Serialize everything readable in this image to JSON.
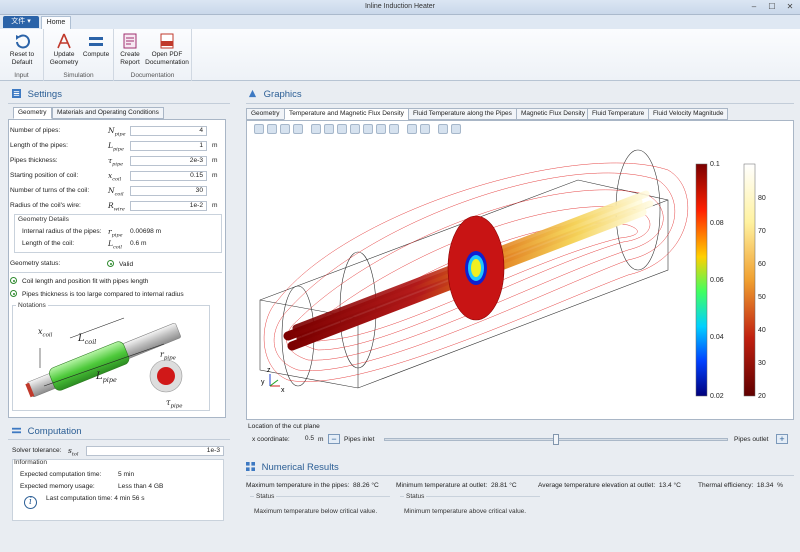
{
  "window": {
    "title": "Inline Induction Heater",
    "controls": [
      "–",
      "☐",
      "✕"
    ]
  },
  "ribbon": {
    "file_label": "文件 ▾",
    "home_label": "Home",
    "groups": [
      {
        "label": "Input",
        "buttons": [
          {
            "label": "Reset to\nDefault",
            "icon": "reset-icon"
          }
        ]
      },
      {
        "label": "Simulation",
        "buttons": [
          {
            "label": "Update\nGeometry",
            "icon": "geometry-icon"
          },
          {
            "label": "Compute",
            "icon": "equals-icon"
          }
        ]
      },
      {
        "label": "Documentation",
        "buttons": [
          {
            "label": "Create\nReport",
            "icon": "report-icon"
          },
          {
            "label": "Open PDF\nDocumentation",
            "icon": "pdf-icon"
          }
        ]
      }
    ]
  },
  "settings": {
    "title": "Settings",
    "tabs": [
      "Geometry",
      "Materials and Operating Conditions"
    ],
    "params": [
      {
        "label": "Number of pipes:",
        "sym": "N",
        "sub": "pipe",
        "value": "4",
        "unit": ""
      },
      {
        "label": "Length of the pipes:",
        "sym": "L",
        "sub": "pipe",
        "value": "1",
        "unit": "m"
      },
      {
        "label": "Pipes thickness:",
        "sym": "τ",
        "sub": "pipe",
        "value": "2e-3",
        "unit": "m"
      },
      {
        "label": "Starting position of coil:",
        "sym": "x",
        "sub": "coil",
        "value": "0.15",
        "unit": "m"
      },
      {
        "label": "Number of turns of the coil:",
        "sym": "N",
        "sub": "coil",
        "value": "30",
        "unit": ""
      },
      {
        "label": "Radius of the coil's wire:",
        "sym": "R",
        "sub": "wire",
        "value": "1e-2",
        "unit": "m"
      }
    ],
    "geometry_details": {
      "title": "Geometry Details",
      "rows": [
        {
          "label": "Internal radius of the pipes:",
          "sym": "r",
          "sub": "pipe",
          "value": "0.00698 m"
        },
        {
          "label": "Length of the coil:",
          "sym": "L",
          "sub": "coil",
          "value": "0.6 m"
        }
      ]
    },
    "geometry_status": {
      "label": "Geometry status:",
      "value": "Valid"
    },
    "messages": [
      "Coil length and position fit with pipes length",
      "Pipes thickness is too large compared to internal radius"
    ],
    "notations": {
      "title": "Notations",
      "labels": {
        "xcoil": "x",
        "xcoil_sub": "coil",
        "lcoil": "L",
        "lcoil_sub": "coil",
        "lpipe": "L",
        "lpipe_sub": "pipe",
        "rpipe": "r",
        "rpipe_sub": "pipe",
        "tpipe": "τ",
        "tpipe_sub": "pipe"
      }
    }
  },
  "computation": {
    "title": "Computation",
    "solver_label": "Solver tolerance:",
    "solver_sym": "s",
    "solver_sub": "tol",
    "solver_value": "1e-3",
    "info_title": "Information",
    "info_rows": [
      {
        "label": "Expected computation time:",
        "value": "5 min"
      },
      {
        "label": "Expected memory usage:",
        "value": "Less than 4 GB"
      },
      {
        "label": "Last computation time:",
        "value": "4 min 56 s"
      }
    ]
  },
  "graphics": {
    "title": "Graphics",
    "tabs": [
      "Geometry",
      "Temperature and Magnetic Flux Density",
      "Fluid Temperature along the Pipes",
      "Magnetic Flux Density",
      "Fluid Temperature",
      "Fluid Velocity Magnitude"
    ],
    "active_tab": 1,
    "colorbar_left": {
      "ticks": [
        "0.1",
        "0.08",
        "0.06",
        "0.04",
        "0.02"
      ]
    },
    "colorbar_right": {
      "ticks": [
        "80",
        "70",
        "60",
        "50",
        "40",
        "30",
        "20"
      ]
    },
    "axis_labels": {
      "y": "y",
      "z": "z",
      "x": "x"
    }
  },
  "cut_plane": {
    "title": "Location of the cut plane",
    "x_label": "x coordinate:",
    "x_value": "0.5",
    "x_unit": "m",
    "inlet_label": "Pipes inlet",
    "outlet_label": "Pipes outlet",
    "slider_fraction": 0.5
  },
  "numerical_results": {
    "title": "Numerical Results",
    "max_temp_label": "Maximum temperature in the pipes:",
    "max_temp_value": "88.26 °C",
    "min_temp_label": "Minimum temperature at outlet:",
    "min_temp_value": "28.81 °C",
    "avg_label": "Average temperature elevation at outlet:",
    "avg_value": "13.4 °C",
    "eff_label": "Thermal efficiency:",
    "eff_value": "18.34",
    "eff_unit": "%",
    "status_label": "Status",
    "status_max": "Maximum temperature below critical value.",
    "status_min": "Minimum temperature above critical value."
  }
}
